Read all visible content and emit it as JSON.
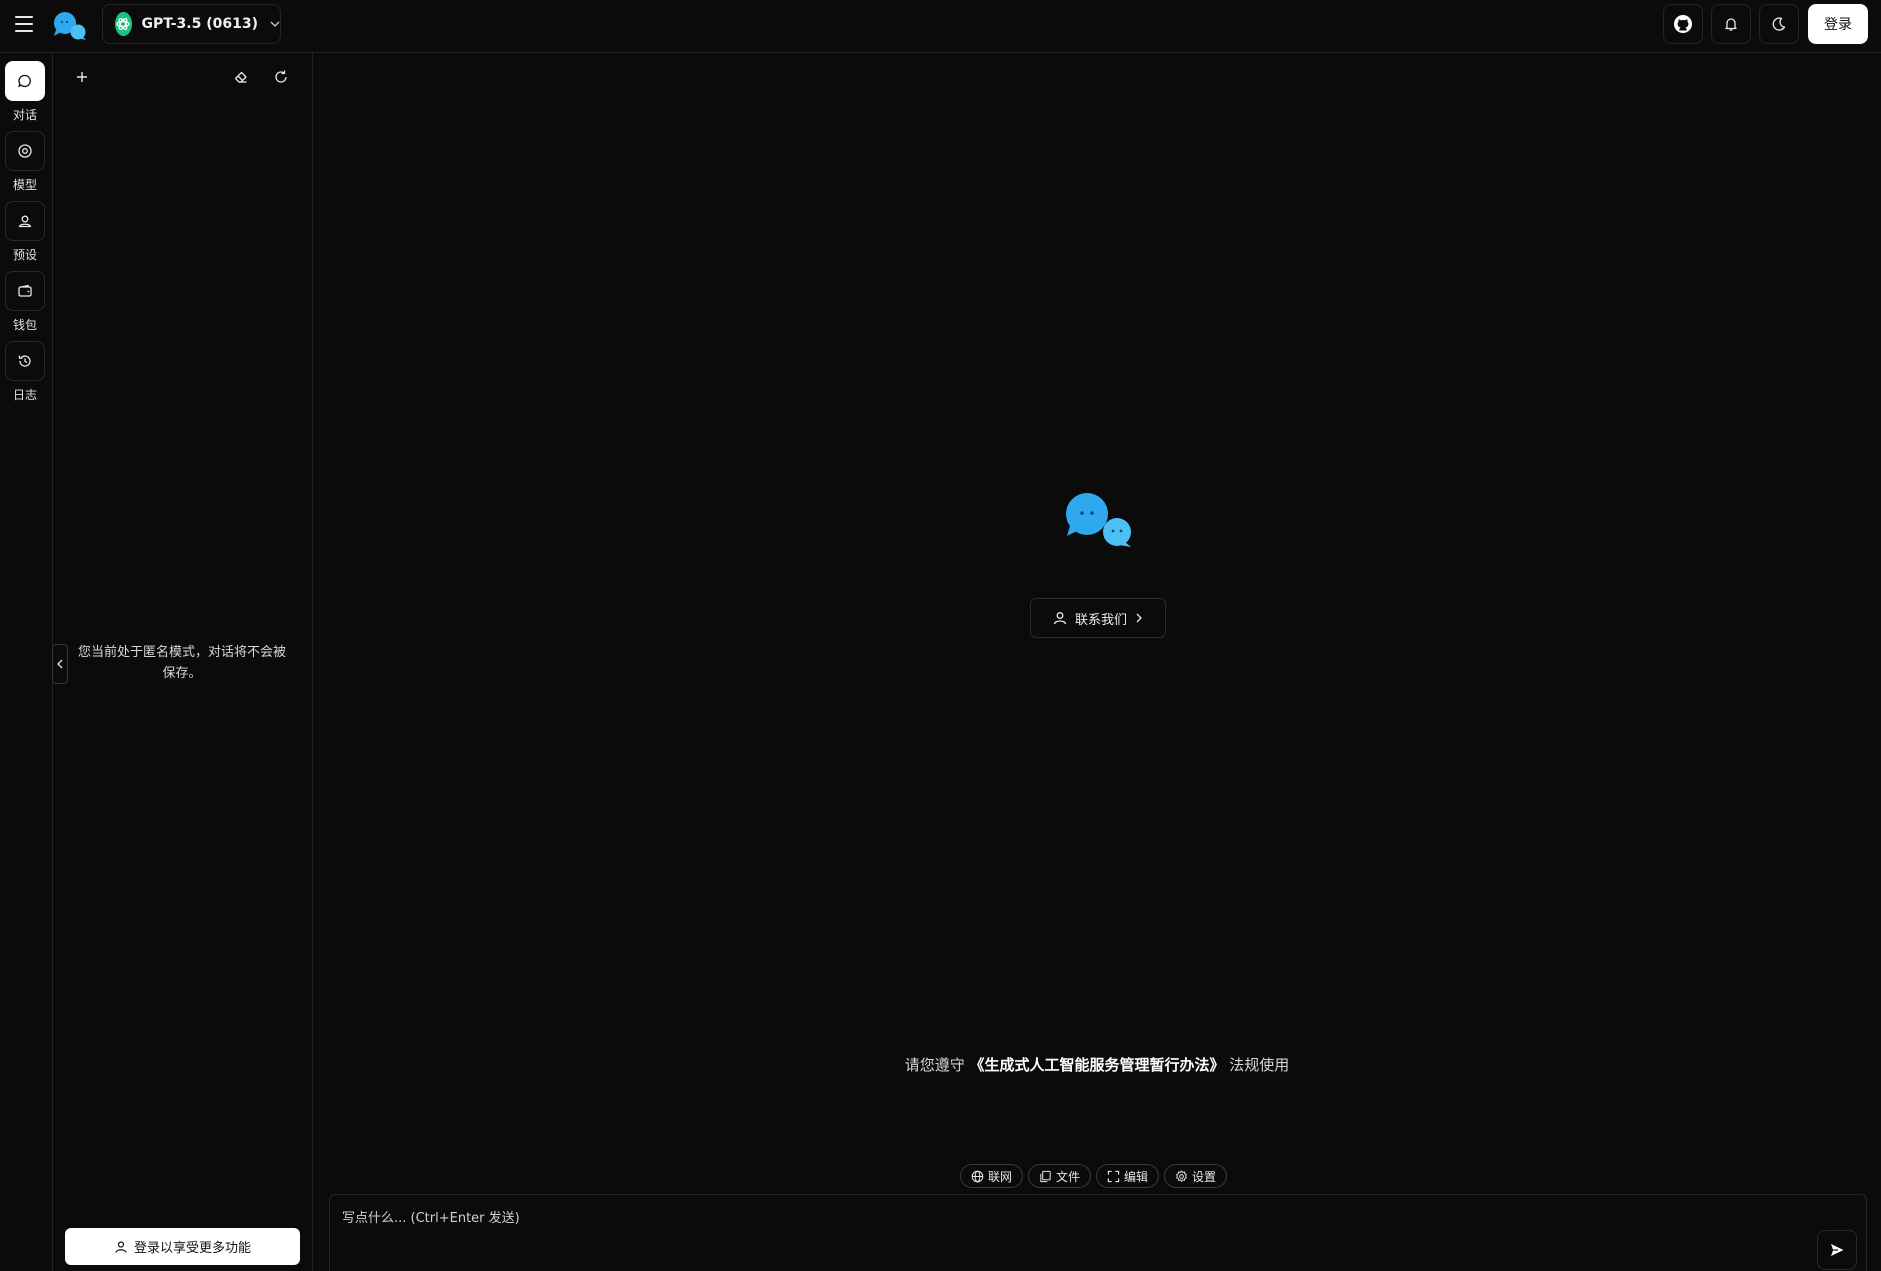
{
  "header": {
    "model_label": "GPT-3.5 (0613)",
    "login_label": "登录",
    "icons": [
      "menu-icon",
      "chat-logo-icon",
      "github-icon",
      "bell-icon",
      "moon-icon"
    ]
  },
  "nav": {
    "items": [
      {
        "label": "对话",
        "icon": "chat-bubble-icon",
        "active": true
      },
      {
        "label": "模型",
        "icon": "model-target-icon",
        "active": false
      },
      {
        "label": "预设",
        "icon": "user-badge-icon",
        "active": false
      },
      {
        "label": "钱包",
        "icon": "wallet-icon",
        "active": false
      },
      {
        "label": "日志",
        "icon": "history-icon",
        "active": false
      }
    ]
  },
  "sidebar": {
    "anonymous_notice": "您当前处于匿名模式，对话将不会被保存。",
    "login_more_label": "登录以享受更多功能"
  },
  "main": {
    "contact_label": "联系我们",
    "notice_prefix": "请您遵守",
    "notice_link": "《生成式人工智能服务管理暂行办法》",
    "notice_suffix": "法规使用",
    "chips": [
      {
        "label": "联网",
        "icon": "globe-icon"
      },
      {
        "label": "文件",
        "icon": "copy-file-icon"
      },
      {
        "label": "编辑",
        "icon": "expand-icon"
      },
      {
        "label": "设置",
        "icon": "gear-icon"
      }
    ],
    "input_placeholder": "写点什么... (Ctrl+Enter 发送)"
  },
  "colors": {
    "background": "#0b0b0c",
    "border": "#222226",
    "accent_blue": "#2ea8ee",
    "gpt_green": "#19c37d"
  }
}
